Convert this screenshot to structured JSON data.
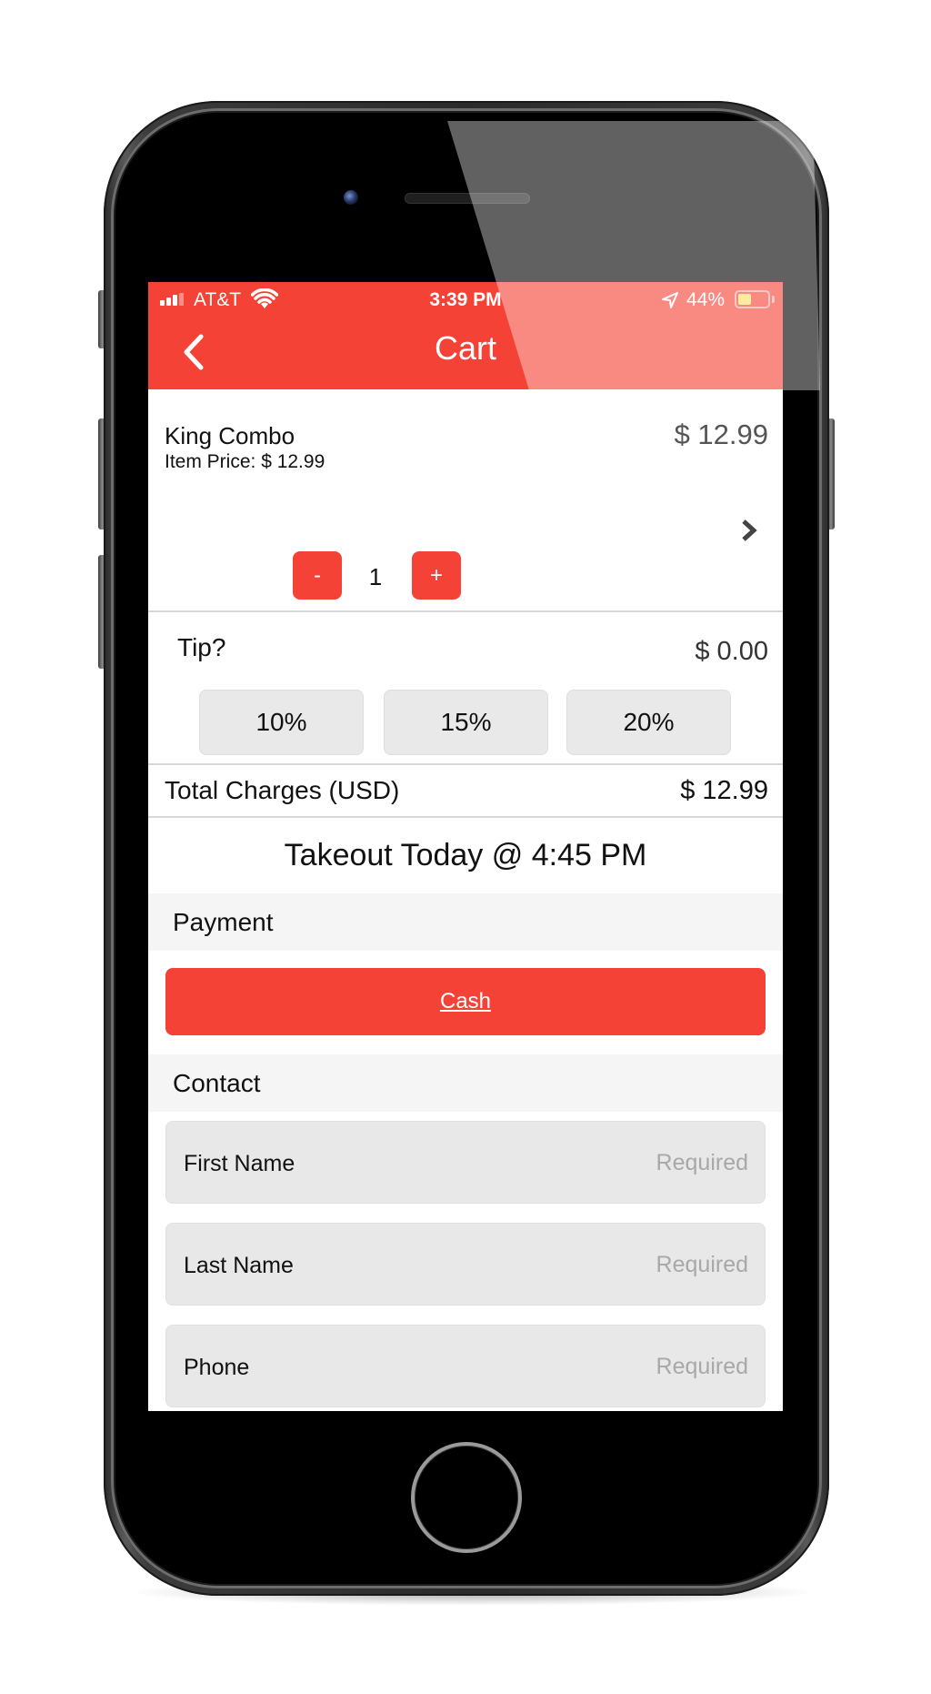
{
  "status_bar": {
    "carrier": "AT&T",
    "time": "3:39 PM",
    "battery_percent_label": "44%",
    "battery_level": 0.44,
    "signal_bars_active": 3,
    "signal_bars_total": 4,
    "icons": [
      "signal-icon",
      "wifi-icon",
      "location-arrow-icon",
      "battery-icon"
    ]
  },
  "header": {
    "title": "Cart",
    "back_icon": "chevron-left-icon",
    "accent_color": "#f44336"
  },
  "cart_item": {
    "name": "King Combo",
    "item_price_label": "Item Price: $ 12.99",
    "line_total": "$ 12.99",
    "details_icon": "chevron-right-icon",
    "quantity": "1",
    "decrement_label": "-",
    "increment_label": "+"
  },
  "tip": {
    "label": "Tip?",
    "amount": "$ 0.00",
    "options": [
      {
        "label": "10%"
      },
      {
        "label": "15%"
      },
      {
        "label": "20%"
      }
    ]
  },
  "totals": {
    "label": "Total Charges (USD)",
    "amount": "$ 12.99"
  },
  "order_time": "Takeout Today @ 4:45 PM",
  "payment": {
    "header": "Payment",
    "method_label": "Cash"
  },
  "contact": {
    "header": "Contact",
    "fields": [
      {
        "label": "First Name",
        "placeholder": "Required",
        "value": ""
      },
      {
        "label": "Last Name",
        "placeholder": "Required",
        "value": ""
      },
      {
        "label": "Phone",
        "placeholder": "Required",
        "value": ""
      }
    ]
  }
}
